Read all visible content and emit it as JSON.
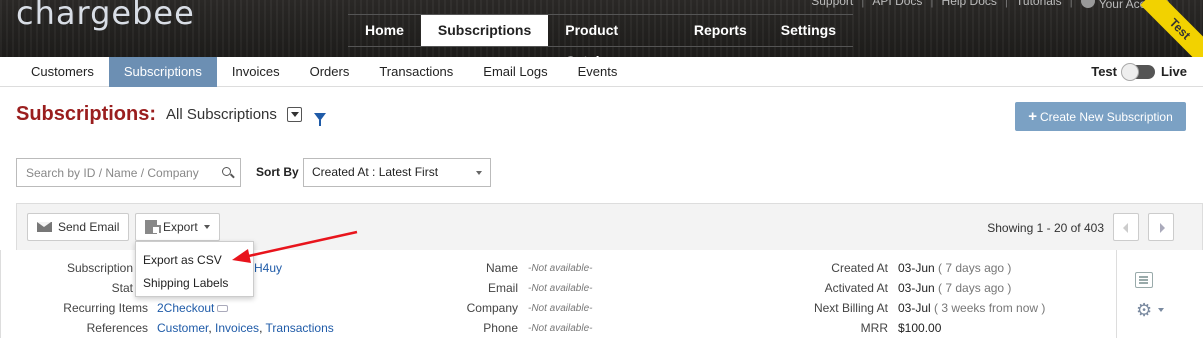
{
  "brand": {
    "logo": "chargebee",
    "test_ribbon": "Test"
  },
  "toplinks": [
    "Support",
    "API Docs",
    "Help Docs",
    "Tutorials",
    "Your Account"
  ],
  "main_nav": [
    {
      "label": "Home",
      "active": false
    },
    {
      "label": "Subscriptions",
      "active": true
    },
    {
      "label": "Product Catalog",
      "active": false
    },
    {
      "label": "Reports",
      "active": false
    },
    {
      "label": "Settings",
      "active": false
    }
  ],
  "sub_nav": [
    {
      "label": "Customers",
      "active": false
    },
    {
      "label": "Subscriptions",
      "active": true
    },
    {
      "label": "Invoices",
      "active": false
    },
    {
      "label": "Orders",
      "active": false
    },
    {
      "label": "Transactions",
      "active": false
    },
    {
      "label": "Email Logs",
      "active": false
    },
    {
      "label": "Events",
      "active": false
    }
  ],
  "mode": {
    "test": "Test",
    "live": "Live"
  },
  "heading": {
    "title": "Subscriptions:",
    "view": "All Subscriptions"
  },
  "create_button": "Create New Subscription",
  "search": {
    "placeholder": "Search by ID / Name / Company"
  },
  "sort": {
    "label": "Sort By",
    "selected": "Created At : Latest First"
  },
  "toolbar": {
    "send_email": "Send Email",
    "export": "Export",
    "showing": "Showing 1 - 20 of 403"
  },
  "export_menu": [
    "Export as CSV",
    "Shipping Labels"
  ],
  "record": {
    "col1": [
      {
        "label": "Subscription",
        "value": "H4uy"
      },
      {
        "label": "Stat",
        "value": ""
      },
      {
        "label": "Recurring Items",
        "value": "2Checkout"
      },
      {
        "label": "References",
        "links": [
          "Customer",
          "Invoices",
          "Transactions"
        ]
      }
    ],
    "col2": [
      {
        "label": "Name",
        "value": "-Not available-"
      },
      {
        "label": "Email",
        "value": "-Not available-"
      },
      {
        "label": "Company",
        "value": "-Not available-"
      },
      {
        "label": "Phone",
        "value": "-Not available-"
      }
    ],
    "col3": [
      {
        "label": "Created At",
        "value": "03-Jun",
        "note": "( 7 days ago )"
      },
      {
        "label": "Activated At",
        "value": "03-Jun",
        "note": "( 7 days ago )"
      },
      {
        "label": "Next Billing At",
        "value": "03-Jul",
        "note": "( 3 weeks from now )"
      },
      {
        "label": "MRR",
        "value": "$100.00",
        "note": ""
      }
    ]
  },
  "colors": {
    "accent_red": "#9a1e1e",
    "nav_blue": "#6c8fb3",
    "button_blue": "#7ba1c4",
    "link": "#1f5ba8",
    "arrow": "#e8141c"
  }
}
